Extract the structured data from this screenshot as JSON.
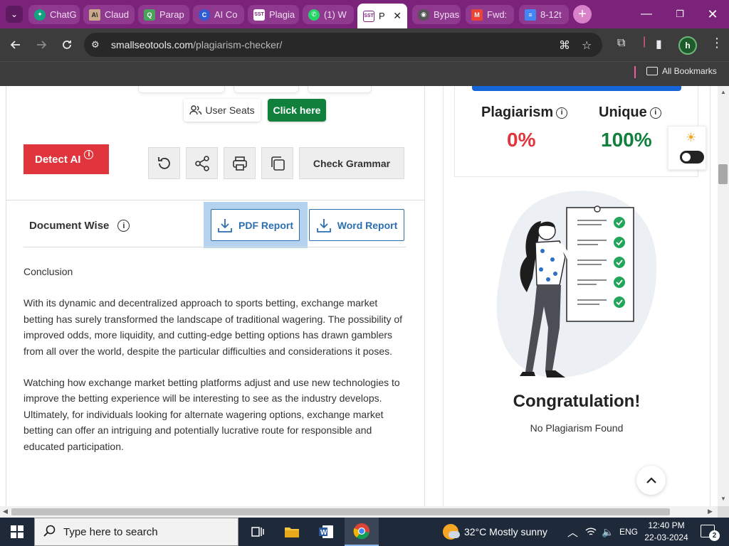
{
  "browser": {
    "tabs": [
      {
        "label": "ChatG",
        "favicon": "chatgpt-icon",
        "color": "#10a37f"
      },
      {
        "label": "Claud",
        "favicon": "anthropic-icon",
        "color": "#c9a98a"
      },
      {
        "label": "Parap",
        "favicon": "quillbot-icon",
        "color": "#4aa35a"
      },
      {
        "label": "AI Co",
        "favicon": "copyleaks-icon",
        "color": "#2f5bd3"
      },
      {
        "label": "Plagia",
        "favicon": "sst-icon",
        "color": "#ffffff"
      },
      {
        "label": "(1) W",
        "favicon": "whatsapp-icon",
        "color": "#25d366"
      },
      {
        "label": "P",
        "favicon": "sst-icon",
        "color": "#ffffff"
      },
      {
        "label": "Bypas",
        "favicon": "undetectable-icon",
        "color": "#555555"
      },
      {
        "label": "Fwd:",
        "favicon": "gmail-icon",
        "color": "#ea4335"
      },
      {
        "label": "8-12t",
        "favicon": "docs-icon",
        "color": "#4285f4"
      }
    ],
    "url_host": "smallseotools.com",
    "url_path": "/plagiarism-checker/",
    "profile_initial": "h",
    "bookmarks_label": "All Bookmarks"
  },
  "page": {
    "user_seats": "User Seats",
    "click_here": "Click here",
    "detect_ai": "Detect AI",
    "check_grammar": "Check Grammar",
    "document_wise": "Document Wise",
    "pdf_report": "PDF Report",
    "word_report": "Word Report",
    "article": [
      "Conclusion",
      "With its dynamic and decentralized approach to sports betting, exchange market betting has surely transformed the landscape of traditional wagering. The possibility of improved odds, more liquidity, and cutting-edge betting options has drawn gamblers from all over the world, despite the particular difficulties and considerations it poses.",
      "Watching how exchange market betting platforms adjust and use new technologies to improve the betting experience will be interesting to see as the industry develops. Ultimately, for individuals looking for alternate wagering options, exchange market betting can offer an intriguing and potentially lucrative route for responsible and educated participation."
    ],
    "plagiarism_label": "Plagiarism",
    "plagiarism_value": "0%",
    "unique_label": "Unique",
    "unique_value": "100%",
    "congrats": "Congratulation!",
    "no_plagiarism": "No Plagiarism Found",
    "colors": {
      "red": "#e0353d",
      "green": "#12803d",
      "blue": "#2c6fb0"
    }
  },
  "taskbar": {
    "search_placeholder": "Type here to search",
    "weather": "32°C  Mostly sunny",
    "language": "ENG",
    "time": "12:40 PM",
    "date": "22-03-2024",
    "notifications": "2"
  }
}
